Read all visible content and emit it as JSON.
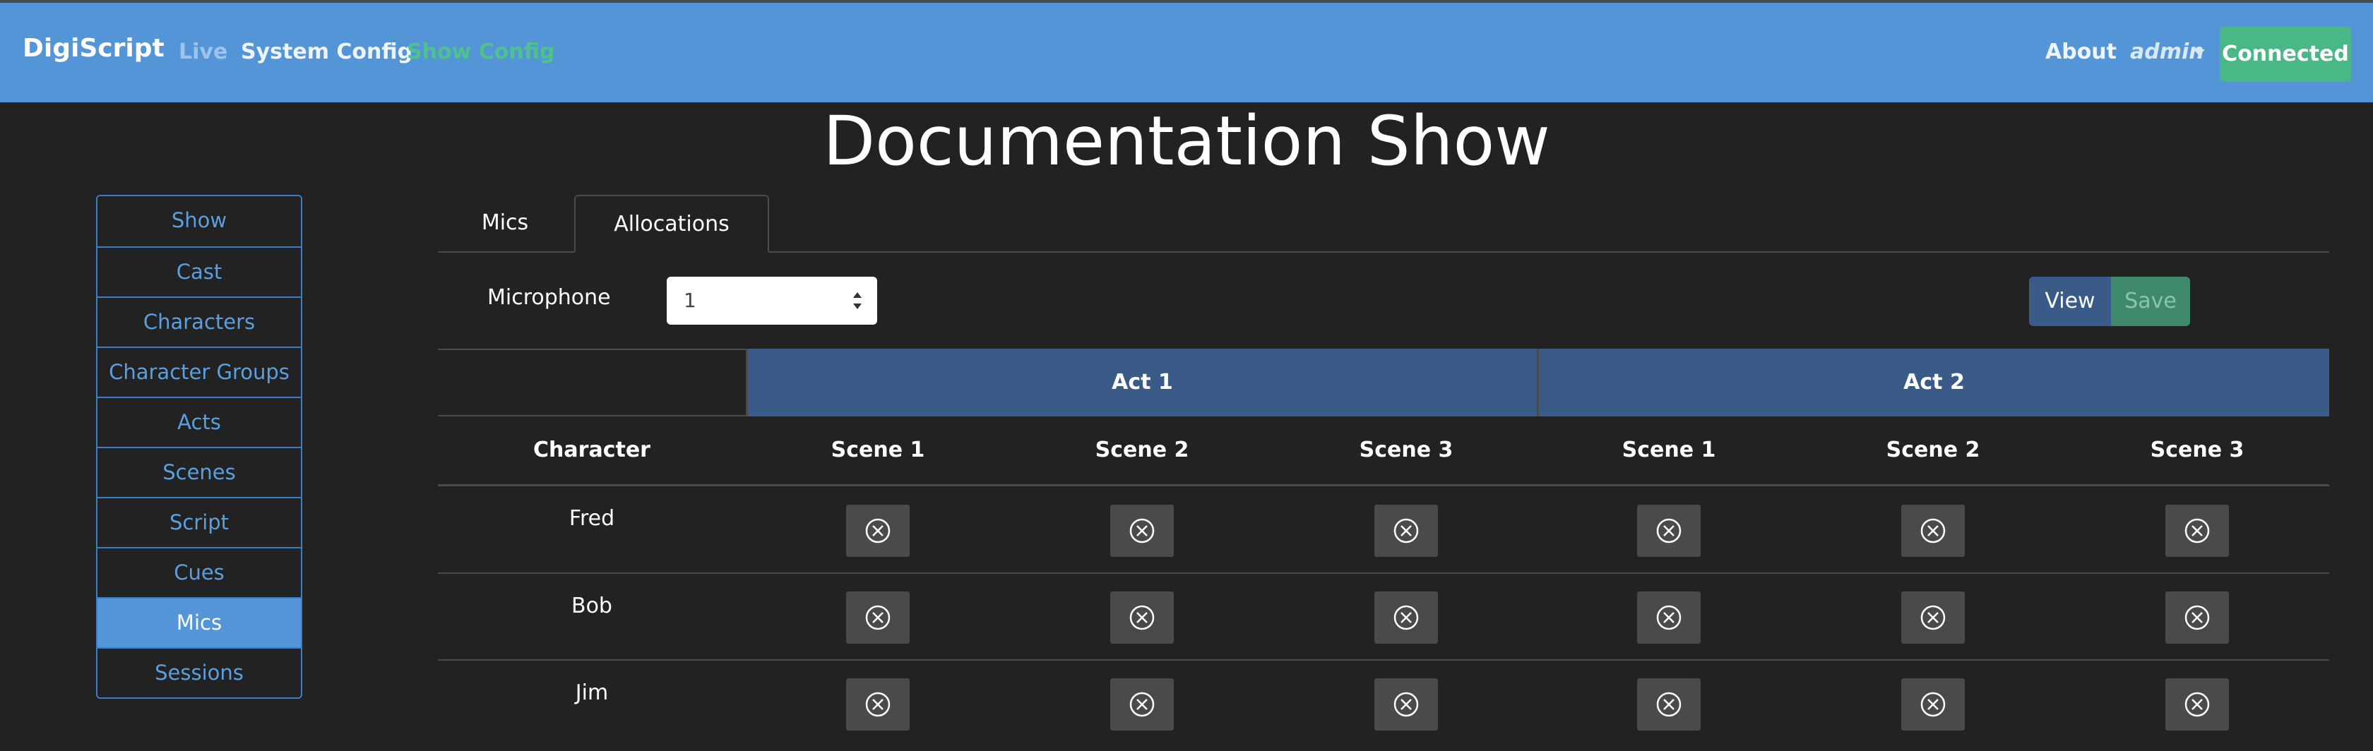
{
  "navbar": {
    "brand": "DigiScript",
    "links": [
      "Live",
      "System Config",
      "Show Config"
    ],
    "about": "About",
    "user": "admin",
    "status": "Connected"
  },
  "page": {
    "title": "Documentation Show"
  },
  "sidebar": {
    "items": [
      {
        "label": "Show"
      },
      {
        "label": "Cast"
      },
      {
        "label": "Characters"
      },
      {
        "label": "Character Groups"
      },
      {
        "label": "Acts"
      },
      {
        "label": "Scenes"
      },
      {
        "label": "Script"
      },
      {
        "label": "Cues"
      },
      {
        "label": "Mics",
        "active": true
      },
      {
        "label": "Sessions"
      }
    ]
  },
  "tabs": [
    {
      "label": "Mics"
    },
    {
      "label": "Allocations",
      "active": true
    }
  ],
  "microphone": {
    "label": "Microphone",
    "selected": "1",
    "view_label": "View",
    "save_label": "Save"
  },
  "table": {
    "acts": [
      "Act 1",
      "Act 2"
    ],
    "headers": [
      "Character",
      "Scene 1",
      "Scene 2",
      "Scene 3",
      "Scene 1",
      "Scene 2",
      "Scene 3"
    ],
    "rows": [
      {
        "character": "Fred",
        "allocations": [
          "x-circle-icon",
          "x-circle-icon",
          "x-circle-icon",
          "x-circle-icon",
          "x-circle-icon",
          "x-circle-icon"
        ]
      },
      {
        "character": "Bob",
        "allocations": [
          "x-circle-icon",
          "x-circle-icon",
          "x-circle-icon",
          "x-circle-icon",
          "x-circle-icon",
          "x-circle-icon"
        ]
      },
      {
        "character": "Jim",
        "allocations": [
          "x-circle-icon",
          "x-circle-icon",
          "x-circle-icon",
          "x-circle-icon",
          "x-circle-icon",
          "x-circle-icon"
        ]
      }
    ]
  },
  "colors": {
    "navbar": "#5395d6",
    "background": "#222222",
    "connected": "#49b886",
    "act_header": "#3a5b88",
    "show_config_link": "#4fc18e"
  }
}
